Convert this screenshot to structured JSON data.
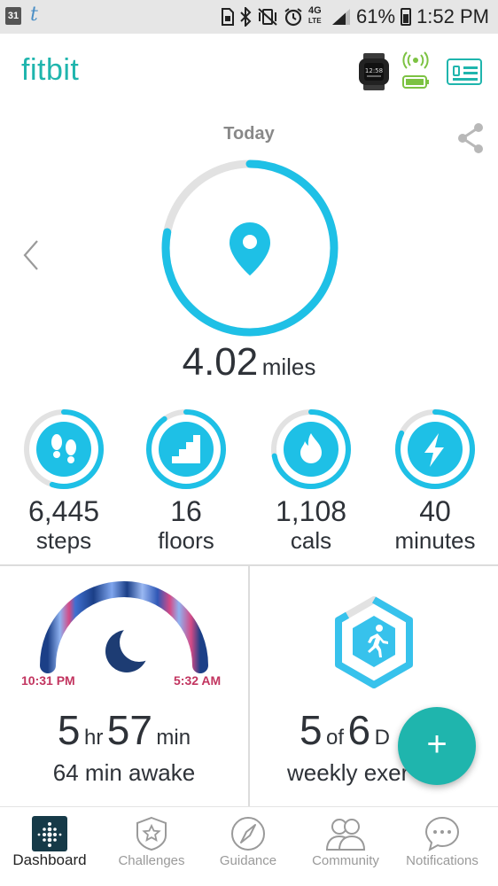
{
  "status_bar": {
    "calendar_day": "31",
    "app_icon": "t",
    "icons": [
      "sim-card-icon",
      "bluetooth-icon",
      "vibrate-mute-icon",
      "alarm-icon",
      "4g-lte-icon",
      "signal-icon"
    ],
    "network": "4G",
    "network_sub": "LTE",
    "battery": "61%",
    "time": "1:52 PM"
  },
  "header": {
    "brand": "fitbit",
    "watch_icon": "watch-device-icon",
    "live_icon": "live-sync-icon",
    "card_icon": "profile-card-icon",
    "colors": {
      "brand": "#1fb5ad",
      "sync_green": "#7cc242"
    }
  },
  "summary": {
    "day_label": "Today",
    "main_value": "4.02",
    "main_unit": "miles",
    "main_progress": 0.78,
    "main_icon": "location-pin-icon"
  },
  "stats": [
    {
      "value": "6,445",
      "label": "steps",
      "icon": "footprints-icon",
      "progress": 0.55
    },
    {
      "value": "16",
      "label": "floors",
      "icon": "stairs-icon",
      "progress": 0.9
    },
    {
      "value": "1,108",
      "label": "cals",
      "icon": "flame-icon",
      "progress": 0.72
    },
    {
      "value": "40",
      "label": "minutes",
      "icon": "lightning-icon",
      "progress": 0.82
    }
  ],
  "sleep_tile": {
    "start_time": "10:31 PM",
    "end_time": "5:32 AM",
    "hours": "5",
    "hours_unit": "hr",
    "minutes": "57",
    "minutes_unit": "min",
    "awake_text": "64 min awake"
  },
  "exercise_tile": {
    "count": "5",
    "of": "of",
    "goal": "6",
    "goal_unit_partial": "D",
    "subtitle": "weekly exer"
  },
  "fab": {
    "label": "+"
  },
  "nav": [
    {
      "label": "Dashboard",
      "icon": "dashboard-icon",
      "active": true
    },
    {
      "label": "Challenges",
      "icon": "challenges-star-badge-icon",
      "active": false
    },
    {
      "label": "Guidance",
      "icon": "compass-icon",
      "active": false
    },
    {
      "label": "Community",
      "icon": "community-people-icon",
      "active": false
    },
    {
      "label": "Notifications",
      "icon": "chat-bubble-icon",
      "active": false
    }
  ]
}
